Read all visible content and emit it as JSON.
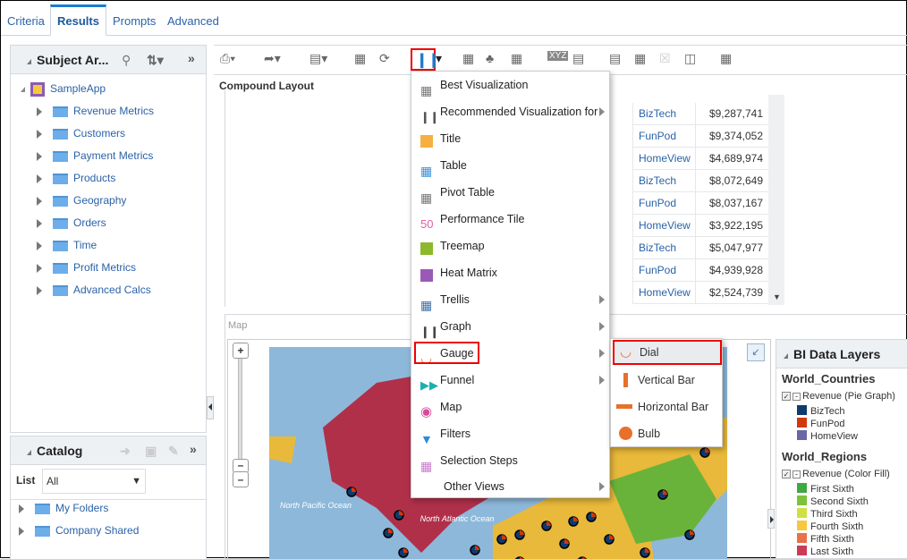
{
  "tabs": [
    "Criteria",
    "Results",
    "Prompts",
    "Advanced"
  ],
  "subject_areas": {
    "title": "Subject Ar...",
    "root": "SampleApp",
    "items": [
      "Revenue Metrics",
      "Customers",
      "Payment Metrics",
      "Products",
      "Geography",
      "Orders",
      "Time",
      "Profit Metrics",
      "Advanced Calcs"
    ]
  },
  "catalog": {
    "title": "Catalog",
    "list_label": "List",
    "list_value": "All",
    "items": [
      "My Folders",
      "Company Shared"
    ]
  },
  "compound_layout": "Compound Layout",
  "table": {
    "rows": [
      [
        "BizTech",
        "$9,287,741"
      ],
      [
        "FunPod",
        "$9,374,052"
      ],
      [
        "HomeView",
        "$4,689,974"
      ],
      [
        "BizTech",
        "$8,072,649"
      ],
      [
        "FunPod",
        "$8,037,167"
      ],
      [
        "HomeView",
        "$3,922,195"
      ],
      [
        "BizTech",
        "$5,047,977"
      ],
      [
        "FunPod",
        "$4,939,928"
      ],
      [
        "HomeView",
        "$2,524,739"
      ]
    ]
  },
  "map": {
    "label": "Map",
    "ocean_labels": [
      "North Pacific Ocean",
      "North Atlantic Ocean"
    ]
  },
  "menu": {
    "items": [
      {
        "label": "Best Visualization",
        "icon": "grid-icon",
        "sub": false
      },
      {
        "label": "Recommended Visualization for",
        "icon": "bar-chart-icon",
        "sub": true
      },
      {
        "label": "Title",
        "icon": "title-icon",
        "sub": false
      },
      {
        "label": "Table",
        "icon": "table-icon",
        "sub": false
      },
      {
        "label": "Pivot Table",
        "icon": "pivot-table-icon",
        "sub": false
      },
      {
        "label": "Performance Tile",
        "icon": "performance-tile-icon",
        "sub": false
      },
      {
        "label": "Treemap",
        "icon": "treemap-icon",
        "sub": false
      },
      {
        "label": "Heat Matrix",
        "icon": "heat-matrix-icon",
        "sub": false
      },
      {
        "label": "Trellis",
        "icon": "trellis-icon",
        "sub": true
      },
      {
        "label": "Graph",
        "icon": "graph-icon",
        "sub": true
      },
      {
        "label": "Gauge",
        "icon": "gauge-icon",
        "sub": true
      },
      {
        "label": "Funnel",
        "icon": "funnel-icon",
        "sub": true
      },
      {
        "label": "Map",
        "icon": "map-icon",
        "sub": false
      },
      {
        "label": "Filters",
        "icon": "filter-icon",
        "sub": false
      },
      {
        "label": "Selection Steps",
        "icon": "selection-steps-icon",
        "sub": false
      },
      {
        "label": "Other Views",
        "icon": "",
        "sub": true
      }
    ],
    "perf_tile_glyph": "50"
  },
  "gauge_submenu": [
    "Dial",
    "Vertical Bar",
    "Horizontal Bar",
    "Bulb"
  ],
  "layers": {
    "title": "BI Data Layers",
    "groups": [
      {
        "name": "World_Countries",
        "layer": "Revenue (Pie Graph)",
        "entries": [
          {
            "label": "BizTech",
            "color": "#0d3b6e"
          },
          {
            "label": "FunPod",
            "color": "#d0390b"
          },
          {
            "label": "HomeView",
            "color": "#6a67a8"
          }
        ]
      },
      {
        "name": "World_Regions",
        "layer": "Revenue (Color Fill)",
        "entries": [
          {
            "label": "First Sixth",
            "color": "#3fa83f"
          },
          {
            "label": "Second Sixth",
            "color": "#7cc23d"
          },
          {
            "label": "Third Sixth",
            "color": "#cfe043"
          },
          {
            "label": "Fourth Sixth",
            "color": "#f8c73c"
          },
          {
            "label": "Fifth Sixth",
            "color": "#e8714a"
          },
          {
            "label": "Last Sixth",
            "color": "#c83c55"
          }
        ]
      }
    ]
  },
  "colors": {
    "accent": "#1b7bd0",
    "link": "#2a62a8",
    "highlight": "#ee0000"
  }
}
